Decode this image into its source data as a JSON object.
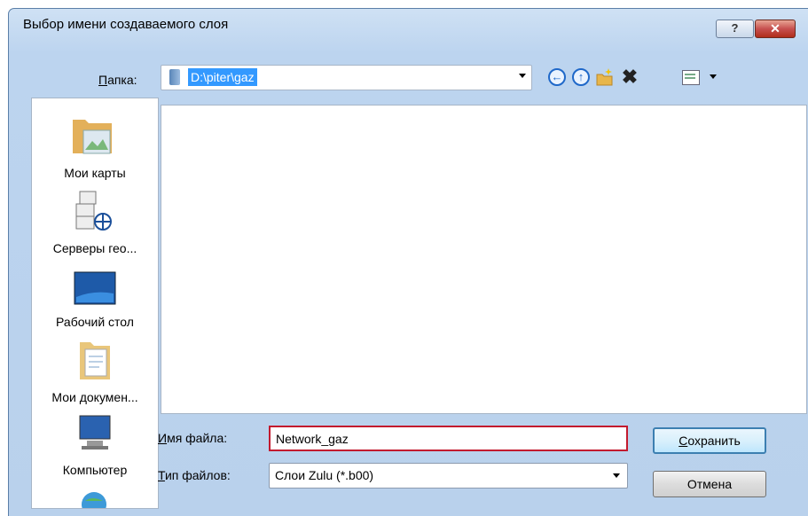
{
  "window": {
    "title": "Выбор имени создаваемого слоя",
    "help_symbol": "?",
    "close_symbol": "✕"
  },
  "toolbar": {
    "folder_label": "Папка:",
    "folder_value": "D:\\piter\\gaz",
    "icons": [
      "back-icon",
      "up-folder-icon",
      "new-folder-icon",
      "delete-icon",
      "view-menu-icon"
    ]
  },
  "places": [
    {
      "label": "Мои карты",
      "icon": "my-maps-icon"
    },
    {
      "label": "Серверы гео...",
      "icon": "geo-servers-icon"
    },
    {
      "label": "Рабочий стол",
      "icon": "desktop-icon"
    },
    {
      "label": "Мои докумен...",
      "icon": "my-documents-icon"
    },
    {
      "label": "Компьютер",
      "icon": "computer-icon"
    }
  ],
  "form": {
    "filename_label": "Имя файла:",
    "filename_value": "Network_gaz",
    "filetype_label": "Тип файлов:",
    "filetype_value": "Слои Zulu (*.b00)"
  },
  "buttons": {
    "save": "Сохранить",
    "cancel": "Отмена"
  },
  "colors": {
    "selection": "#3399ff",
    "filename_border": "#c31a2e",
    "frame": "#bcd4ef"
  }
}
